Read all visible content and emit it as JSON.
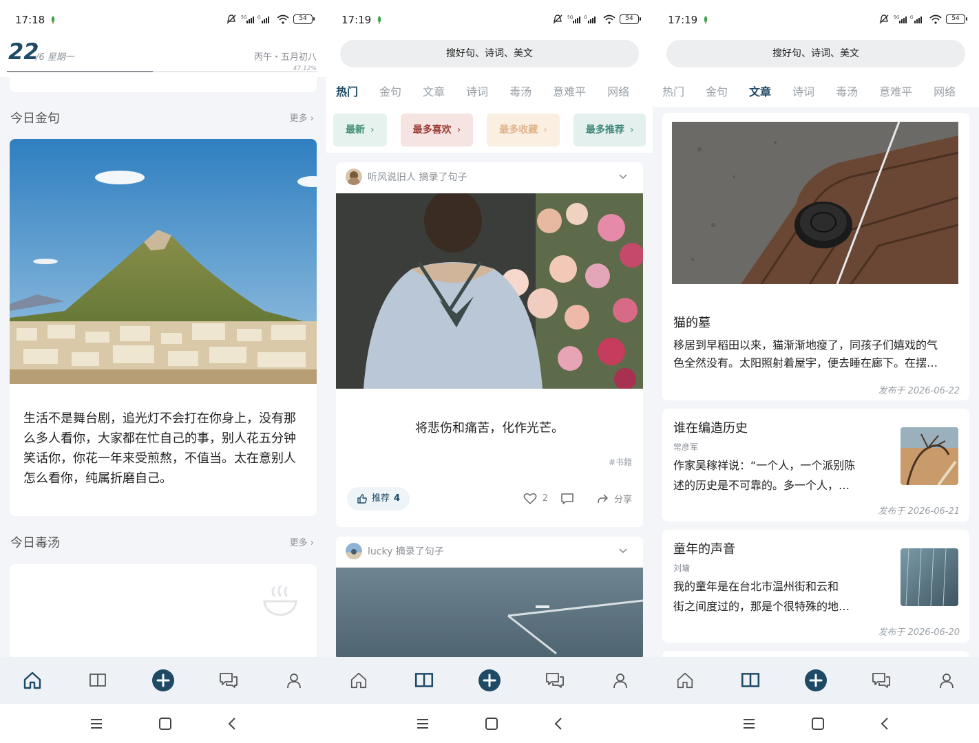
{
  "screen1": {
    "status_time": "17:18",
    "battery": "54",
    "date": {
      "day": "22",
      "rest": "/6 星期一",
      "lunar": "丙午・五月初八",
      "progress": 0.4712,
      "progress_text": "47.12%"
    },
    "golden_title": "今日金句",
    "golden_more": "更多 ›",
    "quote": "生活不是舞台剧，追光灯不会打在你身上，没有那么多人看你，大家都在忙自己的事，别人花五分钟笑话你，你花一年来受煎熬，不值当。太在意别人怎么看你，纯属折磨自己。",
    "poison_title": "今日毒汤",
    "poison_more": "更多 ›"
  },
  "screen2": {
    "status_time": "17:19",
    "battery": "54",
    "search_placeholder": "搜好句、诗词、美文",
    "tabs": [
      "热门",
      "金句",
      "文章",
      "诗词",
      "毒汤",
      "意难平",
      "网络"
    ],
    "chips": [
      {
        "label": "最新",
        "arrow": "›",
        "bg": "#e6f2ee",
        "fg": "#3f8f72"
      },
      {
        "label": "最多喜欢",
        "arrow": "›",
        "bg": "#f5e4e2",
        "fg": "#9a3b33"
      },
      {
        "label": "最多收藏",
        "arrow": "›",
        "bg": "#fbefe2",
        "fg": "#e2b48a"
      },
      {
        "label": "最多推荐",
        "arrow": "›",
        "bg": "#e4f0ee",
        "fg": "#3f8878"
      }
    ],
    "post1": {
      "user": "听风说旧人 摘录了句子",
      "text": "将悲伤和痛苦，化作光芒。",
      "tag": "#书籍",
      "recommend_label": "推荐",
      "recommend_count": "4",
      "like_count": "2",
      "share_label": "分享"
    },
    "post2": {
      "user": "lucky 摘录了句子"
    }
  },
  "screen3": {
    "status_time": "17:19",
    "battery": "54",
    "search_placeholder": "搜好句、诗词、美文",
    "tabs": [
      "热门",
      "金句",
      "文章",
      "诗词",
      "毒汤",
      "意难平",
      "网络"
    ],
    "articles": [
      {
        "title": "猫的墓",
        "body1": "移居到早稻田以来，猫渐渐地瘦了，同孩子们嬉戏的气",
        "body2": "色全然没有。太阳照射着屋宇，便去睡在廊下。在摆…",
        "date": "发布于 2026-06-22"
      },
      {
        "title": "谁在编造历史",
        "author": "常彦军",
        "body1": "作家吴稼祥说：“一个人，一个派别陈",
        "body2": "述的历史是不可靠的。多一个人，…",
        "date": "发布于 2026-06-21"
      },
      {
        "title": "童年的声音",
        "author": "刘墉",
        "body1": "我的童年是在台北市温州街和云和",
        "body2": "街之间度过的，那是个很特殊的地…",
        "date": "发布于 2026-06-20"
      }
    ]
  },
  "colors": {
    "accent": "#1e4a66",
    "muted": "#8a8f95",
    "bg": "#f3f5f8"
  }
}
